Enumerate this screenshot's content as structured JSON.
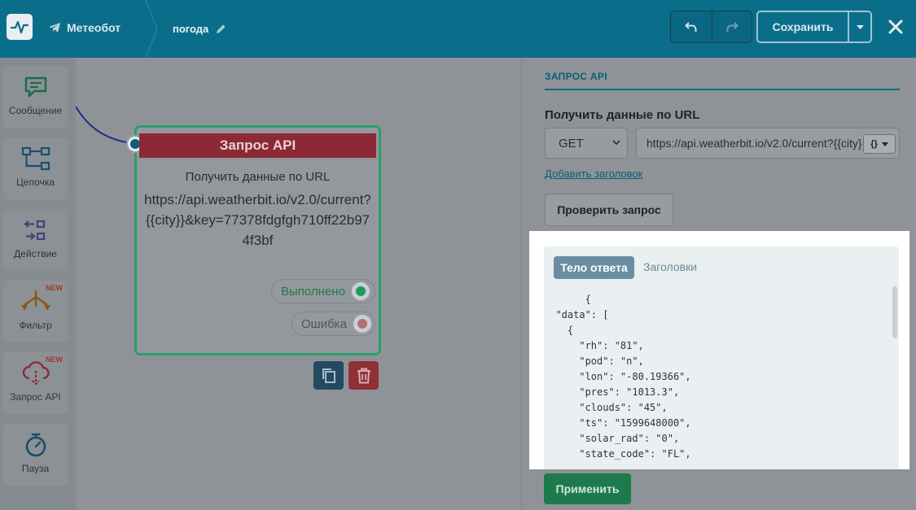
{
  "header": {
    "bot_name": "Метеобот",
    "flow_name": "погода",
    "save_label": "Сохранить",
    "colors": {
      "bar": "#0a6e8a",
      "accent": "#9ec3d1"
    }
  },
  "sidebar": {
    "items": [
      {
        "label": "Сообщение",
        "icon": "message-icon",
        "new": ""
      },
      {
        "label": "Цепочка",
        "icon": "chain-icon",
        "new": ""
      },
      {
        "label": "Действие",
        "icon": "action-icon",
        "new": ""
      },
      {
        "label": "Фильтр",
        "icon": "filter-icon",
        "new": "NEW"
      },
      {
        "label": "Запрос API",
        "icon": "api-request-icon",
        "new": "NEW"
      },
      {
        "label": "Пауза",
        "icon": "timer-icon",
        "new": ""
      }
    ]
  },
  "node": {
    "title": "Запрос API",
    "subtitle": "Получить данные по URL",
    "url": "https://api.weatherbit.io/v2.0/current?{{city}}&key=77378fdgfgh710ff22b974f3bf",
    "exit_success": "Выполнено",
    "exit_error": "Ошибка"
  },
  "panel": {
    "title": "ЗАПРОС API",
    "label": "Получить данные по URL",
    "method": "GET",
    "url_value": "https://api.weatherbit.io/v2.0/current?{{city}}",
    "var_button": "{}",
    "add_header": "Добавить заголовок",
    "check_button": "Проверить запрос",
    "tabs": {
      "body": "Тело ответа",
      "headers": "Заголовки"
    },
    "response_lines": [
      "       {",
      "  \"data\": [",
      "    {",
      "      \"rh\": \"81\",",
      "      \"pod\": \"n\",",
      "      \"lon\": \"-80.19366\",",
      "      \"pres\": \"1013.3\",",
      "      \"clouds\": \"45\",",
      "      \"ts\": \"1599648000\",",
      "      \"solar_rad\": \"0\",",
      "      \"state_code\": \"FL\","
    ],
    "apply_button": "Применить"
  }
}
